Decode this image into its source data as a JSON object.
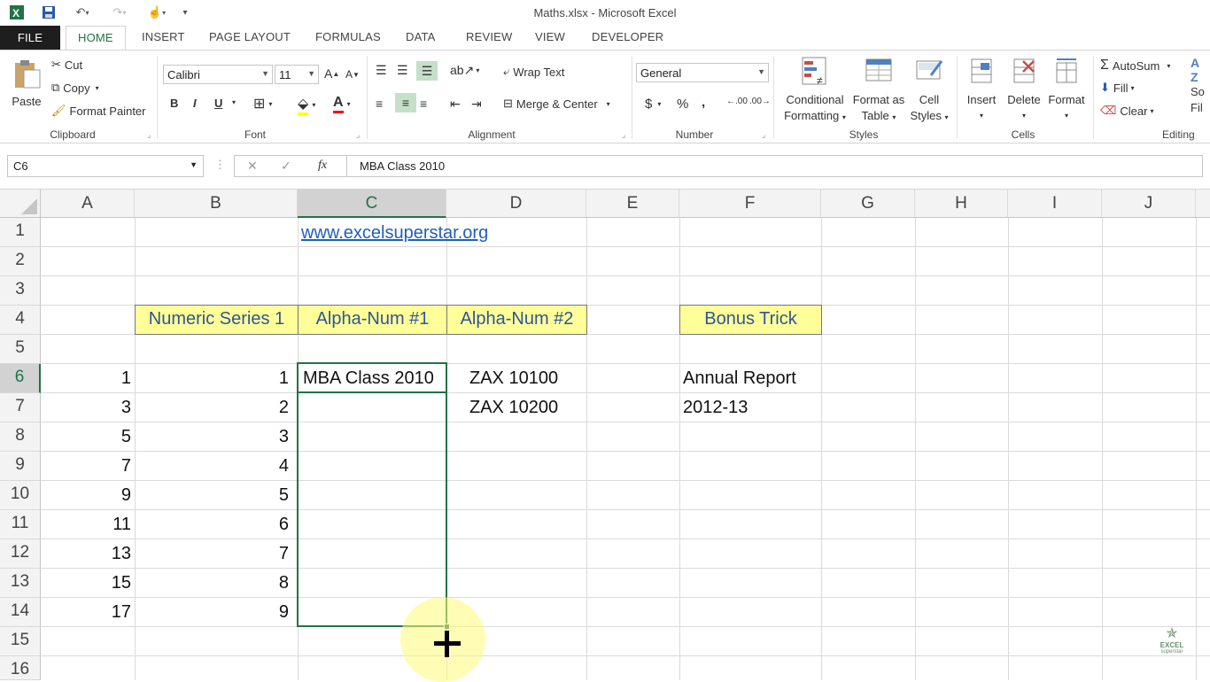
{
  "window": {
    "title": "Maths.xlsx - Microsoft Excel"
  },
  "tabs": [
    "FILE",
    "HOME",
    "INSERT",
    "PAGE LAYOUT",
    "FORMULAS",
    "DATA",
    "REVIEW",
    "VIEW",
    "DEVELOPER"
  ],
  "ribbon": {
    "clipboard": {
      "paste": "Paste",
      "cut": "Cut",
      "copy": "Copy",
      "format_painter": "Format Painter",
      "label": "Clipboard"
    },
    "font": {
      "name": "Calibri",
      "size": "11",
      "bold": "B",
      "italic": "I",
      "underline": "U",
      "label": "Font"
    },
    "alignment": {
      "wrap_text": "Wrap Text",
      "merge_center": "Merge & Center",
      "label": "Alignment"
    },
    "number": {
      "format": "General",
      "currency": "$",
      "percent": "%",
      "comma": ",",
      "label": "Number"
    },
    "styles": {
      "conditional": [
        "Conditional",
        "Formatting"
      ],
      "format_table": [
        "Format as",
        "Table"
      ],
      "cell_styles": [
        "Cell",
        "Styles"
      ],
      "label": "Styles"
    },
    "cells": {
      "insert": "Insert",
      "delete": "Delete",
      "format": "Format",
      "label": "Cells"
    },
    "editing": {
      "autosum": "AutoSum",
      "fill": "Fill",
      "clear": "Clear",
      "sort": "So",
      "find": "Fil",
      "label": "Editing"
    }
  },
  "formula_bar": {
    "name_box": "C6",
    "fx": "fx",
    "value": "MBA Class 2010"
  },
  "columns": [
    "A",
    "B",
    "C",
    "D",
    "E",
    "F",
    "G",
    "H",
    "I",
    "J"
  ],
  "rows": [
    "1",
    "2",
    "3",
    "4",
    "5",
    "6",
    "7",
    "8",
    "9",
    "10",
    "11",
    "12",
    "13",
    "14",
    "15",
    "16"
  ],
  "cells": {
    "C1": "www.excelsuperstar.org",
    "B4": "Numeric Series 1",
    "C4": "Alpha-Num #1",
    "D4": "Alpha-Num #2",
    "F4": "Bonus Trick",
    "A": [
      "1",
      "3",
      "5",
      "7",
      "9",
      "11",
      "13",
      "15",
      "17"
    ],
    "B": [
      "1",
      "2",
      "3",
      "4",
      "5",
      "6",
      "7",
      "8",
      "9"
    ],
    "C6": "MBA Class 2010",
    "D6": "ZAX 10100",
    "D7": "ZAX 10200",
    "F6": "Annual Report",
    "F7": "2012-13"
  },
  "watermark": {
    "line1": "EXCEL",
    "line2": "superstar"
  },
  "colors": {
    "accent": "#217346",
    "header_fill": "#ffff99",
    "header_text": "#2f5597"
  }
}
